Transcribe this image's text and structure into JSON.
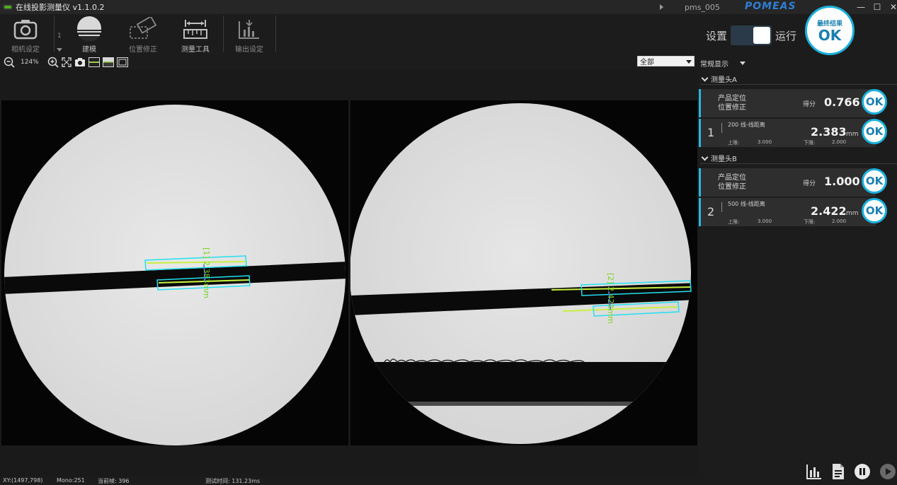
{
  "titlebar": {
    "title": "在线投影测量仪 v1.1.0.2",
    "device_name": "pms_005",
    "brand": "POMEAS",
    "minimize": "—",
    "maximize": "☐",
    "close": "✕"
  },
  "toolbar": {
    "camera_settings": "相机设定",
    "index": "1",
    "modeling": "建模",
    "position_correction": "位置修正",
    "measure_tools": "测量工具",
    "output_settings": "输出设定"
  },
  "viewbar": {
    "zoom": "124%",
    "filter_value": "全部"
  },
  "run_mode": {
    "settings_label": "设置",
    "run_label": "运行",
    "final_result_title": "最终结果",
    "final_result_value": "OK"
  },
  "panel": {
    "display_mode": "常规显示",
    "groups": [
      {
        "name": "测量头A",
        "position_card": {
          "line1": "产品定位",
          "line2": "位置修正",
          "score_label": "得分",
          "score": "0.766",
          "result": "OK"
        },
        "measure_card": {
          "index": "1",
          "name": "200 线-线距离",
          "value": "2.383",
          "unit": "mm",
          "upper_label": "上限:",
          "upper": "3.000",
          "lower_label": "下限:",
          "lower": "2.000",
          "result": "OK"
        }
      },
      {
        "name": "测量头B",
        "position_card": {
          "line1": "产品定位",
          "line2": "位置修正",
          "score_label": "得分",
          "score": "1.000",
          "result": "OK"
        },
        "measure_card": {
          "index": "2",
          "name": "500 线-线距离",
          "value": "2.422",
          "unit": "mm",
          "upper_label": "上限:",
          "upper": "3.000",
          "lower_label": "下限:",
          "lower": "2.000",
          "result": "OK"
        }
      }
    ]
  },
  "viewports": {
    "cam_a_label": "[1] 2.383mm",
    "cam_b_label": "[2] 2.422mm"
  },
  "statusbar": {
    "xy": "XY:(1497,798)",
    "mono": "Mono:251",
    "frame": "当前帧: 396",
    "test_time": "测试时间: 131.23ms"
  },
  "colors": {
    "accent": "#1bb0dc",
    "brand": "#2e7fd6",
    "roi": "#22e0f0",
    "edge": "#c8f040"
  }
}
